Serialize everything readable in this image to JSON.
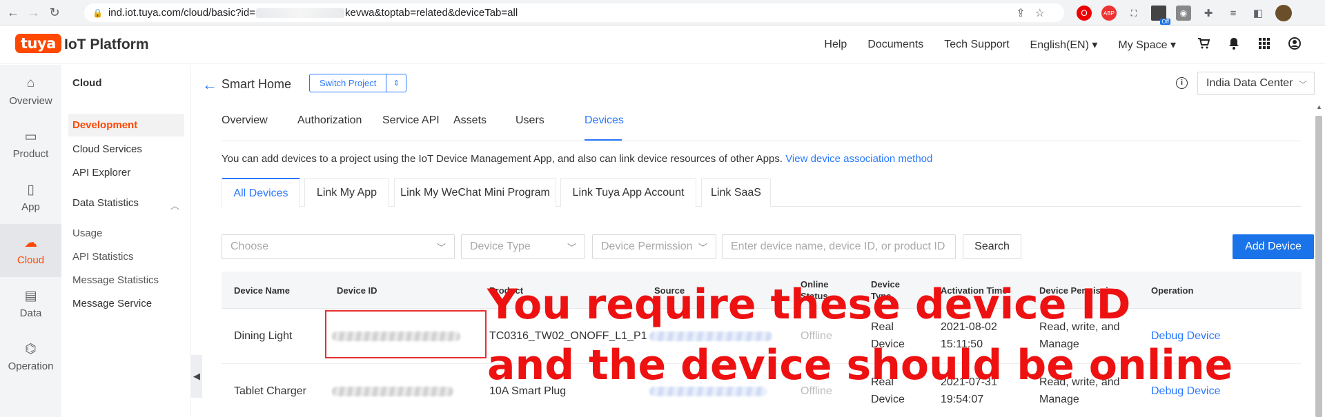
{
  "browser": {
    "url_prefix": "ind.iot.tuya.com/cloud/basic?id=",
    "url_suffix": "kevwa&toptab=related&deviceTab=all",
    "ext_badge": "Off"
  },
  "header": {
    "logo": "tuya",
    "title": "IoT Platform",
    "menu": [
      {
        "label": "Help"
      },
      {
        "label": "Documents"
      },
      {
        "label": "Tech Support"
      },
      {
        "label": "English(EN) ▾"
      },
      {
        "label": "My Space ▾"
      }
    ],
    "icons": [
      "cart-icon",
      "bell-icon",
      "apps-grid-icon",
      "user-icon"
    ]
  },
  "sidebar": {
    "items": [
      {
        "label": "Overview",
        "icon": "⌂"
      },
      {
        "label": "Product",
        "icon": "▭"
      },
      {
        "label": "App",
        "icon": "▯"
      },
      {
        "label": "Cloud",
        "icon": "☁"
      },
      {
        "label": "Data",
        "icon": "▤"
      },
      {
        "label": "Operation",
        "icon": "⌬"
      }
    ]
  },
  "subnav": {
    "title": "Cloud",
    "items": [
      "Development",
      "Cloud Services",
      "API Explorer",
      "Data Statistics",
      "Usage",
      "API Statistics",
      "Message Statistics",
      "Message Service"
    ]
  },
  "project": {
    "title": "Smart Home",
    "switch_label": "Switch Project",
    "data_center": "India Data Center"
  },
  "tabs": [
    "Overview",
    "Authorization",
    "Service API",
    "Assets",
    "Users",
    "Devices"
  ],
  "description": {
    "text": "You can add devices to a project using the IoT Device Management App, and also can link device resources of other Apps.",
    "link": "View device association method"
  },
  "sub_tabs": [
    "All Devices",
    "Link My App",
    "Link My WeChat Mini Program",
    "Link Tuya App Account",
    "Link SaaS"
  ],
  "filters": {
    "choose_placeholder": "Choose",
    "device_type_placeholder": "Device Type",
    "device_permission_placeholder": "Device Permission",
    "search_placeholder": "Enter device name, device ID, or product ID",
    "search_button": "Search",
    "add_button": "Add Device"
  },
  "table": {
    "headers": {
      "name": "Device Name",
      "id": "Device ID",
      "product": "Product",
      "source": "Source",
      "status_1": "Online",
      "status_2": "Status",
      "type_1": "Device",
      "type_2": "Type",
      "activation": "Activation Time",
      "permission": "Device Permission",
      "operation": "Operation"
    },
    "rows": [
      {
        "name": "Dining Light",
        "product": "TC0316_TW02_ONOFF_L1_P1",
        "status": "Offline",
        "type_1": "Real",
        "type_2": "Device",
        "date": "2021-08-02",
        "time": "15:11:50",
        "perm_1": "Read, write, and",
        "perm_2": "Manage",
        "op": "Debug Device"
      },
      {
        "name": "Tablet Charger",
        "product": "10A Smart Plug",
        "status": "Offline",
        "type_1": "Real",
        "type_2": "Device",
        "date": "2021-07-31",
        "time": "19:54:07",
        "perm_1": "Read, write, and",
        "perm_2": "Manage",
        "op": "Debug Device"
      }
    ]
  },
  "annotation": {
    "line1": "You require these device ID",
    "line2": "and the device should be online",
    "color": "#ee1111"
  },
  "colors": {
    "brand": "#ff4800",
    "accent": "#2878ff",
    "primary_button": "#1a73e8"
  }
}
